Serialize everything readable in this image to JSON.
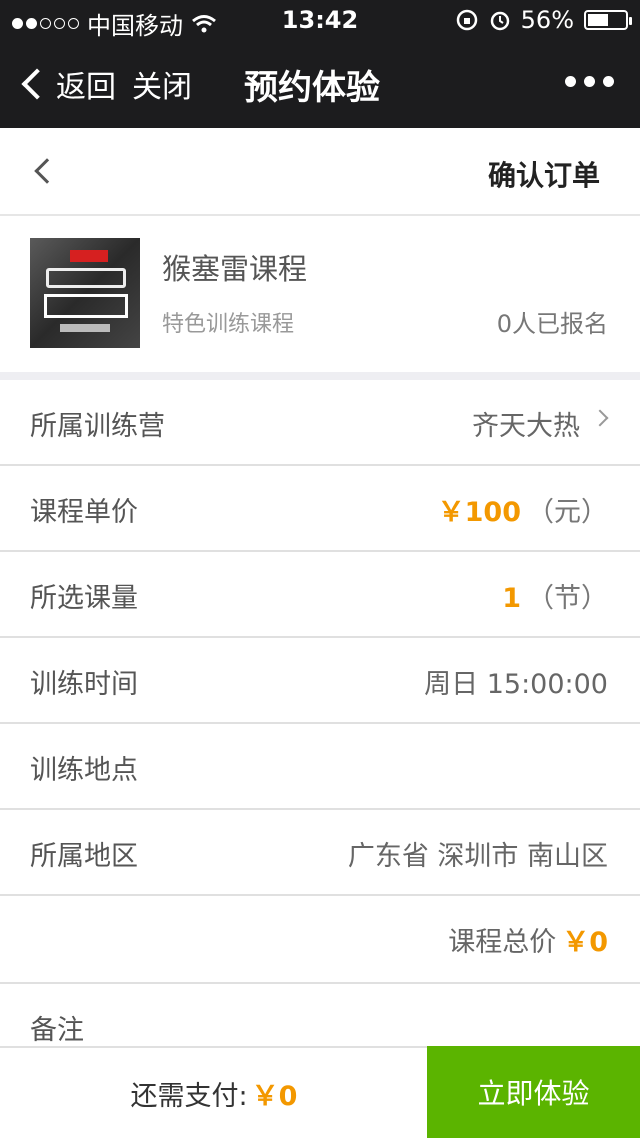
{
  "status_bar": {
    "carrier": "中国移动",
    "time": "13:42",
    "battery_percent": "56%",
    "battery_level": 0.56,
    "signal_bars_filled": 2,
    "signal_bars_total": 5,
    "icons": [
      "wifi-icon",
      "rotation-lock-icon",
      "alarm-icon",
      "battery-icon"
    ]
  },
  "nav": {
    "back_label": "返回",
    "close_label": "关闭",
    "title": "预约体验",
    "more_icon": "more-dots-icon"
  },
  "page": {
    "title": "确认订单"
  },
  "course": {
    "name": "猴塞雷课程",
    "type": "特色训练课程",
    "enrolled": "0人已报名"
  },
  "rows": {
    "camp": {
      "label": "所属训练营",
      "value": "齐天大热"
    },
    "unit_price": {
      "label": "课程单价",
      "value": "￥100",
      "unit": "（元）"
    },
    "quantity": {
      "label": "所选课量",
      "value": "1",
      "unit": "（节）"
    },
    "time": {
      "label": "训练时间",
      "value": "周日 15:00:00"
    },
    "location": {
      "label": "训练地点",
      "value": ""
    },
    "region": {
      "label": "所属地区",
      "value": "广东省 深圳市 南山区"
    },
    "total": {
      "label": "课程总价",
      "value": "￥0"
    },
    "remark": {
      "label": "备注"
    }
  },
  "bottom": {
    "pay_label": "还需支付:",
    "pay_amount": "￥0",
    "cta_label": "立即体验"
  },
  "colors": {
    "nav_bg": "#1c1c1e",
    "accent_orange": "#f39800",
    "cta_green": "#5bb400",
    "divider": "#e0e0e0"
  }
}
